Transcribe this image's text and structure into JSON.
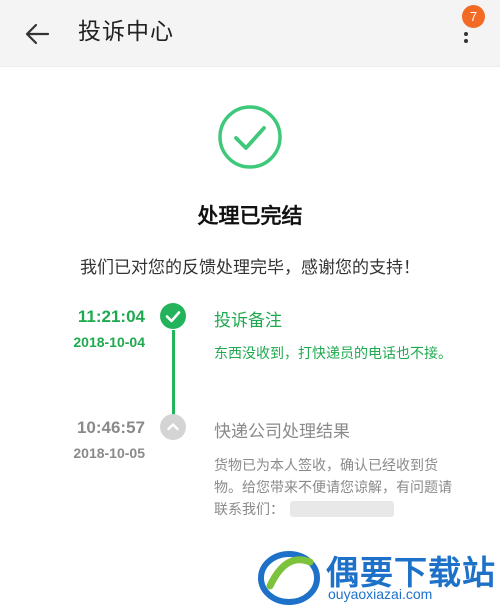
{
  "header": {
    "title": "投诉中心",
    "badge_count": "7",
    "back_icon": "arrow-left-icon",
    "menu_icon": "more-vertical-icon"
  },
  "status": {
    "icon": "check-circle-icon",
    "title": "处理已完结",
    "subtitle": "我们已对您的反馈处理完毕，感谢您的支持！"
  },
  "timeline": [
    {
      "time": "11:21:04",
      "date": "2018-10-04",
      "title": "投诉备注",
      "description": "东西没收到，打快递员的电话也不接。",
      "state": "current",
      "color": "#23b35a"
    },
    {
      "time": "10:46:57",
      "date": "2018-10-05",
      "title": "快递公司处理结果",
      "description": "货物已为本人签收，确认已经收到货物。给您带来不便请您谅解，有问题请联系我们：",
      "state": "past",
      "color": "#d4d4d4"
    }
  ],
  "watermark": {
    "text": "偶要下载站",
    "url": "ouyaoxiazai.com"
  },
  "colors": {
    "accent": "#23b35a",
    "badge": "#f26a24",
    "watermark": "#1d71c9"
  }
}
